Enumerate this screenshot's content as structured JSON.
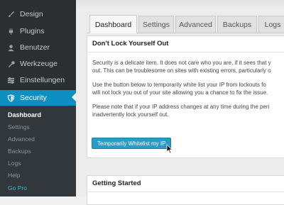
{
  "sidebar": {
    "items": [
      {
        "label": "Design",
        "icon": "brush-icon"
      },
      {
        "label": "Plugins",
        "icon": "plug-icon"
      },
      {
        "label": "Benutzer",
        "icon": "user-icon"
      },
      {
        "label": "Werkzeuge",
        "icon": "wrench-icon"
      },
      {
        "label": "Einstellungen",
        "icon": "settings-icon"
      },
      {
        "label": "Security",
        "icon": "shield-icon"
      }
    ],
    "submenu": [
      {
        "label": "Dashboard"
      },
      {
        "label": "Settings"
      },
      {
        "label": "Advanced"
      },
      {
        "label": "Backups"
      },
      {
        "label": "Logs"
      },
      {
        "label": "Help"
      },
      {
        "label": "Go Pro"
      }
    ],
    "active_color": "#0e8fc2"
  },
  "tabs": [
    {
      "label": "Dashboard"
    },
    {
      "label": "Settings"
    },
    {
      "label": "Advanced"
    },
    {
      "label": "Backups"
    },
    {
      "label": "Logs"
    }
  ],
  "panel": {
    "title": "Don't Lock Yourself Out",
    "paragraphs": [
      [
        "Security is a delicate item. It does not care who you are, if it sees that y",
        "out. This can be troublesome on sites with existing errors, particularly o"
      ],
      [
        "Use the button below to temporarily white list your IP from lockouts fo",
        "will not lock you out of your site allowing you a chance to fix the issue."
      ],
      [
        "Please note that if your IP address changes at any time during the peri",
        "inadvertently lock yourself out."
      ]
    ],
    "button_label": "Temporarily Whitelist my IP",
    "button_color": "#2b9ac6"
  },
  "panel2": {
    "title": "Getting Started"
  }
}
